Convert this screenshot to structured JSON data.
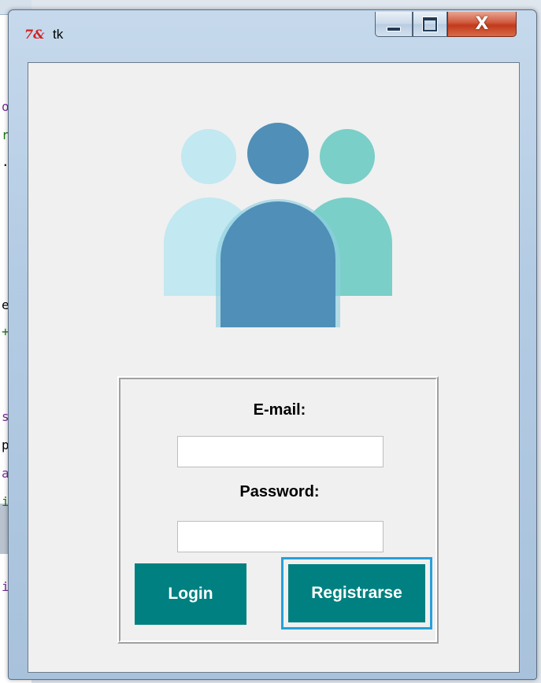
{
  "window": {
    "title": "tk",
    "app_icon": "tk-feather-icon",
    "controls": {
      "minimize": "minimize-icon",
      "maximize": "maximize-icon",
      "close_glyph": "X"
    }
  },
  "logo": {
    "icon": "user-group-icon",
    "colors": {
      "left": "#c2e8f1",
      "right": "#7acfc8",
      "center": "#4f8fb8"
    }
  },
  "form": {
    "email_label": "E-mail:",
    "email_value": "",
    "password_label": "Password:",
    "password_value": "",
    "login_label": "Login",
    "register_label": "Registrarse",
    "button_color": "#008080",
    "focus_color": "#26a0da"
  },
  "background_editor": {
    "visible_chars": [
      "o",
      "r",
      ".",
      "e",
      "+",
      "s",
      "p",
      "a",
      "i",
      "i"
    ]
  }
}
